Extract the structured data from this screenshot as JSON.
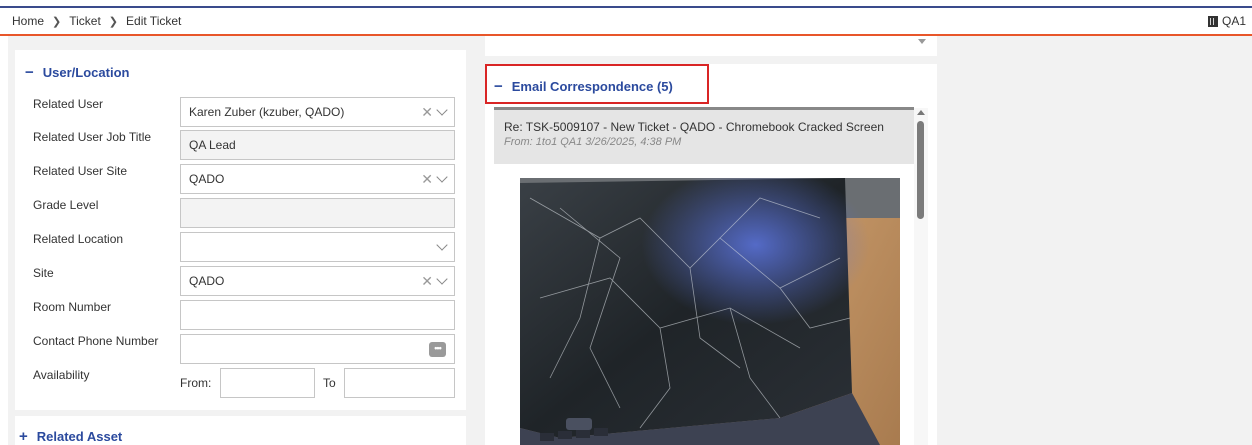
{
  "breadcrumb": [
    "Home",
    "Ticket",
    "Edit Ticket"
  ],
  "user_badge": "QA1",
  "user_location": {
    "title": "User/Location",
    "toggle": "−",
    "fields": {
      "related_user": {
        "label": "Related User",
        "value": "Karen Zuber (kzuber, QADO)"
      },
      "job_title": {
        "label": "Related User Job Title",
        "value": "QA Lead"
      },
      "user_site": {
        "label": "Related User Site",
        "value": "QADO"
      },
      "grade_level": {
        "label": "Grade Level",
        "value": ""
      },
      "related_location": {
        "label": "Related Location",
        "value": ""
      },
      "site": {
        "label": "Site",
        "value": "QADO"
      },
      "room_number": {
        "label": "Room Number",
        "value": ""
      },
      "contact_phone": {
        "label": "Contact Phone Number",
        "value": ""
      },
      "availability": {
        "label": "Availability",
        "from_label": "From:",
        "to_label": "To",
        "from": "",
        "to": ""
      }
    }
  },
  "related_asset": {
    "title": "Related Asset",
    "toggle": "+"
  },
  "email": {
    "title": "Email Correspondence (5)",
    "toggle": "−",
    "message": {
      "subject": "Re: TSK-5009107 - New Ticket - QADO - Chromebook Cracked Screen",
      "from": "From: 1to1 QA1 3/26/2025, 4:38 PM"
    }
  },
  "colors": {
    "accent": "#2b4a9e",
    "header_border": "#e8562a",
    "highlight": "#d92525"
  },
  "icons": {
    "clear": "clear-icon",
    "dropdown": "chevron-down-icon",
    "phone_picker": "more-dots-icon",
    "site": "building-icon"
  }
}
